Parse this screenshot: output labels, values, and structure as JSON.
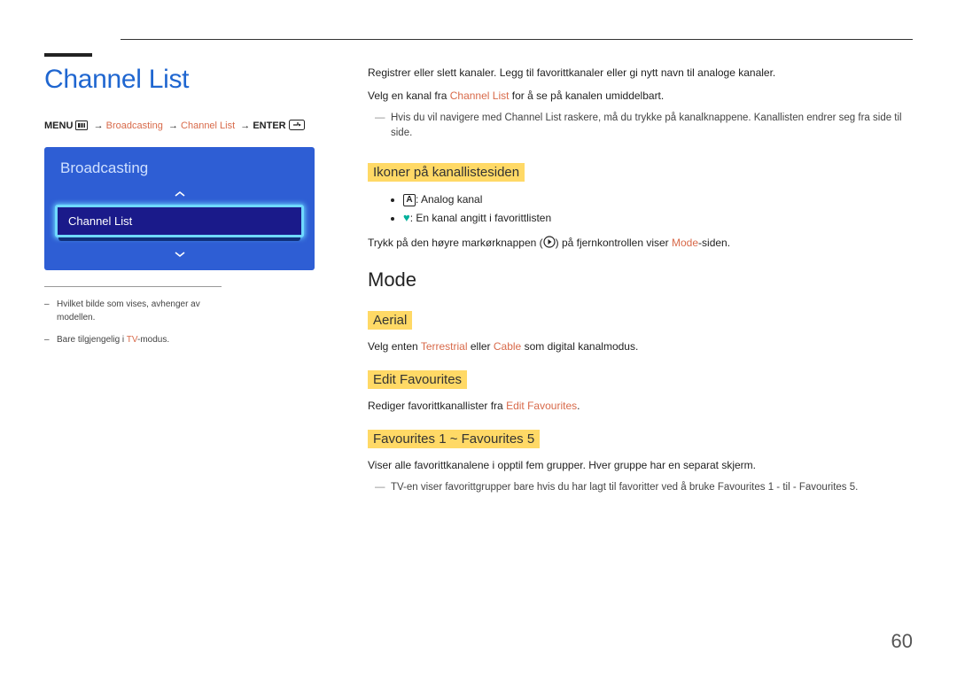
{
  "page_number": "60",
  "title": "Channel List",
  "breadcrumb": {
    "menu": "MENU",
    "broadcasting": "Broadcasting",
    "channel_list": "Channel List",
    "enter": "ENTER"
  },
  "panel": {
    "header": "Broadcasting",
    "selected_item": "Channel List"
  },
  "left_notes": {
    "note1": "Hvilket bilde som vises, avhenger av modellen.",
    "note2_pre": "Bare tilgjengelig i ",
    "note2_coral": "TV",
    "note2_post": "-modus."
  },
  "intro": {
    "p1": "Registrer eller slett kanaler. Legg til favorittkanaler eller gi nytt navn til analoge kanaler.",
    "p2_pre": "Velg en kanal fra ",
    "p2_link": "Channel List",
    "p2_post": " for å se på kanalen umiddelbart.",
    "dash_pre": "Hvis du vil navigere med ",
    "dash_link": "Channel List",
    "dash_post": " raskere, må du trykke på kanalknappene. Kanallisten endrer seg fra side til side."
  },
  "sections": {
    "icons": {
      "heading": "Ikoner på kanallistesiden",
      "b1_label": "A",
      "b1_text": ": Analog kanal",
      "b2_text": ": En kanal angitt i favorittlisten",
      "p_pre": "Trykk på den høyre markørknappen (",
      "p_post": ") på fjernkontrollen viser ",
      "p_link": "Mode",
      "p_end": "-siden."
    },
    "mode_heading": "Mode",
    "aerial": {
      "heading": "Aerial",
      "p_pre": "Velg enten ",
      "p_l1": "Terrestrial",
      "p_mid": " eller ",
      "p_l2": "Cable",
      "p_post": " som digital kanalmodus."
    },
    "edit_fav": {
      "heading": "Edit Favourites",
      "p_pre": "Rediger favorittkanallister fra ",
      "p_link": "Edit Favourites",
      "p_post": "."
    },
    "fav15": {
      "heading": "Favourites 1 ~ Favourites 5",
      "p1": "Viser alle favorittkanalene i opptil fem grupper. Hver gruppe har en separat skjerm.",
      "dash_pre": "TV-en viser favorittgrupper bare hvis du har lagt til favoritter ved å bruke ",
      "dash_l1": "Favourites 1",
      "dash_mid": " - til - ",
      "dash_l2": "Favourites 5",
      "dash_post": "."
    }
  }
}
